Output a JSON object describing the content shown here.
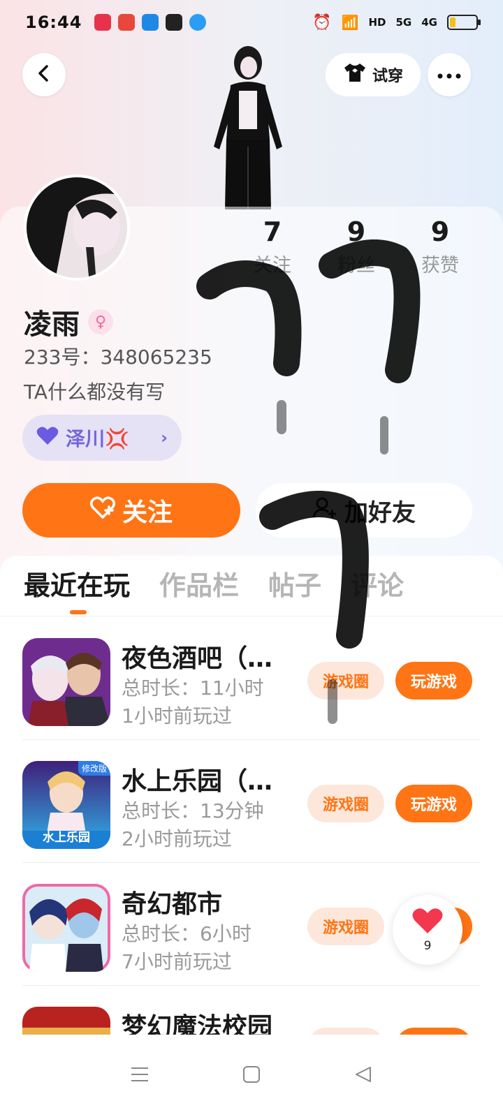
{
  "status_bar": {
    "time": "16:44",
    "network_labels": [
      "HD",
      "5G",
      "4G"
    ],
    "battery_level": 0.2
  },
  "header": {
    "tryon_label": "试穿",
    "icons": [
      "back-icon",
      "shirt-icon",
      "more-icon"
    ]
  },
  "profile": {
    "name": "凌雨",
    "gender": "female",
    "uid_text": "233号：348065235",
    "bio": "TA什么都没有写",
    "relation_label": "泽川💢",
    "stats": [
      {
        "value": "7",
        "label": "关注"
      },
      {
        "value": "9",
        "label": "粉丝"
      },
      {
        "value": "9",
        "label": "获赞"
      }
    ]
  },
  "actions": {
    "follow_label": "关注",
    "add_friend_label": "加好友"
  },
  "tabs": [
    {
      "label": "最近在玩",
      "active": true
    },
    {
      "label": "作品栏",
      "active": false
    },
    {
      "label": "帖子",
      "active": false
    },
    {
      "label": "评论",
      "active": false
    }
  ],
  "games": [
    {
      "title": "夜色酒吧（…",
      "duration": "总时长：11小时",
      "last_played": "1小时前玩过",
      "circle_label": "游戏圈",
      "play_label": "玩游戏"
    },
    {
      "title": "水上乐园（…",
      "duration": "总时长：13分钟",
      "last_played": "2小时前玩过",
      "circle_label": "游戏圈",
      "play_label": "玩游戏",
      "thumb_badge": "水上乐园",
      "thumb_corner": "修改版"
    },
    {
      "title": "奇幻都市",
      "duration": "总时长：6小时",
      "last_played": "7小时前玩过",
      "circle_label": "游戏圈",
      "play_label": "玩游戏"
    },
    {
      "title": "梦幻魔法校园"
    }
  ],
  "like_float": {
    "count": "9"
  },
  "colors": {
    "accent": "#ff7414",
    "relation": "#7566d8"
  }
}
